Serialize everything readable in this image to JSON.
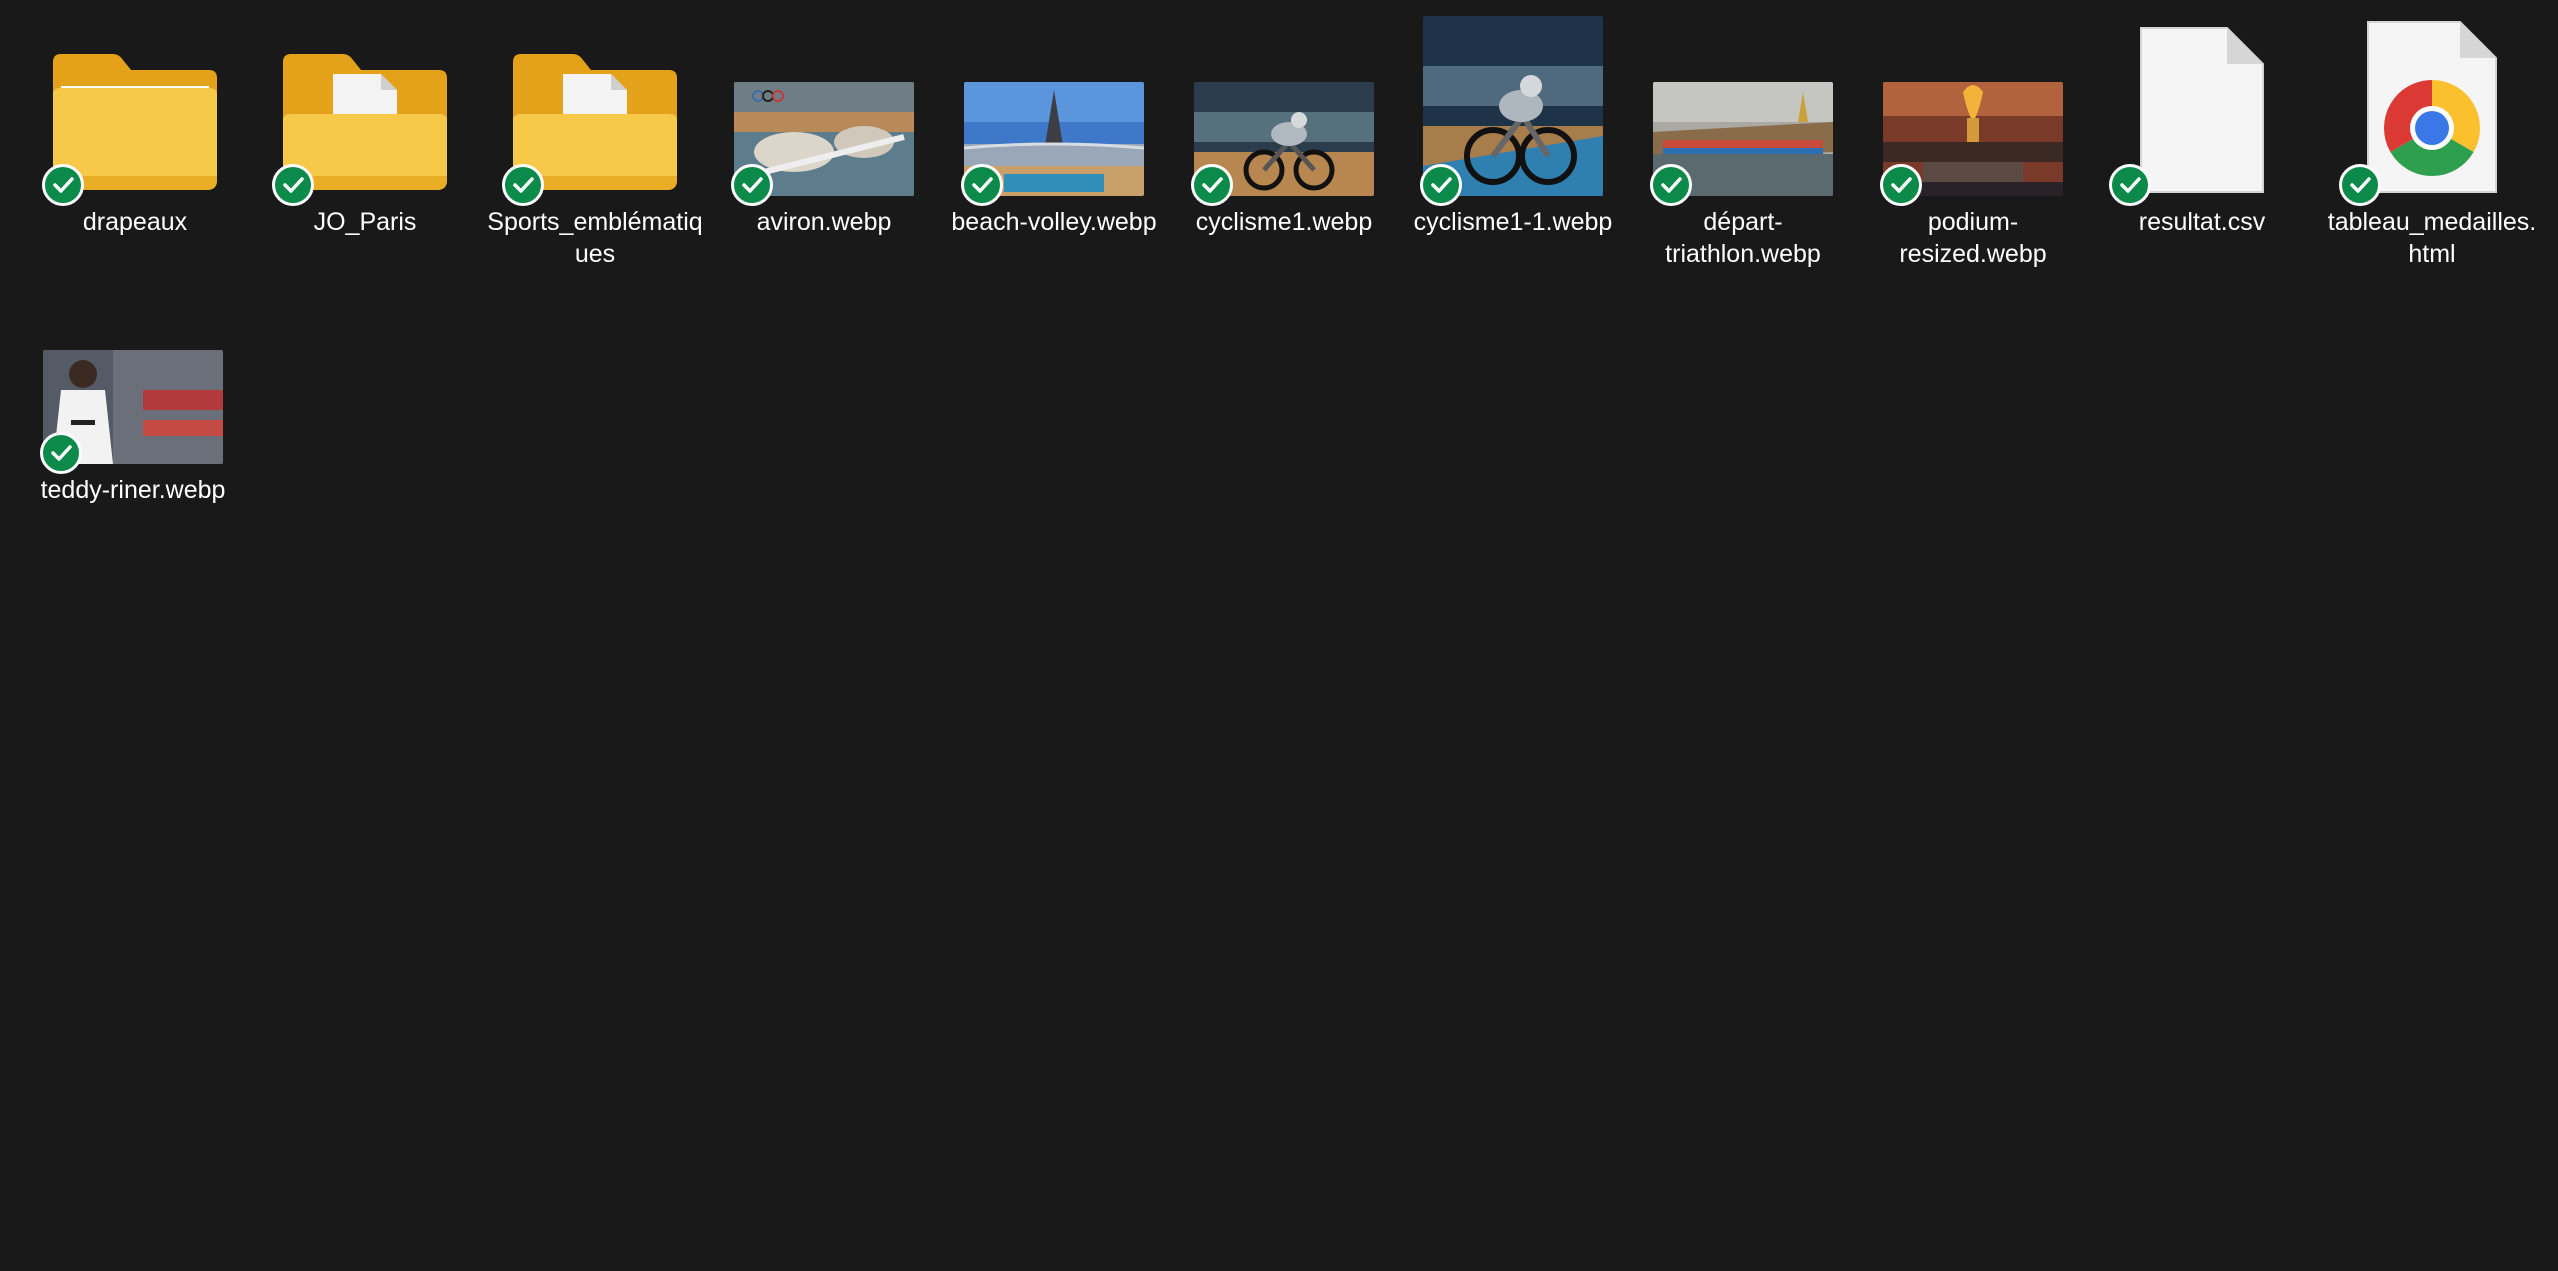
{
  "items": [
    {
      "name": "drapeaux",
      "kind": "folder"
    },
    {
      "name": "JO_Paris",
      "kind": "folder-doc"
    },
    {
      "name": "Sports_emblématiques",
      "kind": "folder-doc"
    },
    {
      "name": "aviron.webp",
      "kind": "image"
    },
    {
      "name": "beach-volley.webp",
      "kind": "image"
    },
    {
      "name": "cyclisme1.webp",
      "kind": "image"
    },
    {
      "name": "cyclisme1-1.webp",
      "kind": "image"
    },
    {
      "name": "départ-triathlon.webp",
      "kind": "image"
    },
    {
      "name": "podium-resized.webp",
      "kind": "image"
    },
    {
      "name": "resultat.csv",
      "kind": "file"
    },
    {
      "name": "tableau_medailles.html",
      "kind": "html"
    },
    {
      "name": "teddy-riner.webp",
      "kind": "image"
    }
  ],
  "sync_status": "synced-check-icon",
  "colors": {
    "background": "#191919",
    "folder": "#f6c23e",
    "sync": "#0b8a4a"
  }
}
